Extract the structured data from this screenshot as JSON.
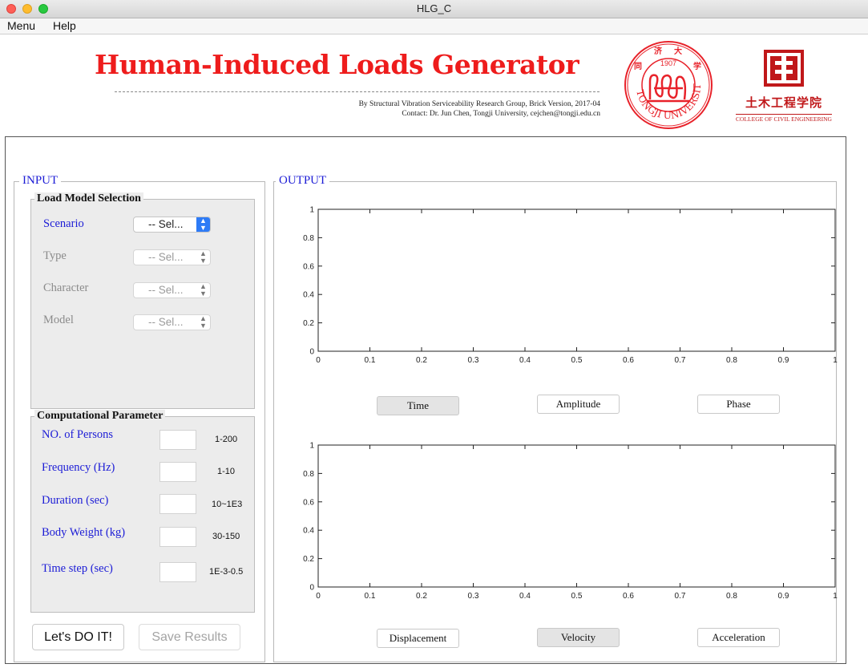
{
  "window": {
    "title": "HLG_C"
  },
  "menubar": {
    "items": [
      "Menu",
      "Help"
    ]
  },
  "header": {
    "title": "Human-Induced Loads Generator",
    "credit_line1": "By Structural Vibration Serviceability Research Group, Brick Version, 2017-04",
    "credit_line2": "Contact: Dr. Jun Chen, Tongji University, cejchen@tongji.edu.cn",
    "seal_year": "1907",
    "seal_text": "TONGJI UNIVERSITY",
    "college_cn": "土木工程学院",
    "college_en": "COLLEGE OF CIVIL ENGINEERING"
  },
  "input": {
    "title": "INPUT",
    "load_model": {
      "title": "Load Model Selection",
      "rows": [
        {
          "label": "Scenario",
          "value": "-- Sel...",
          "enabled": true
        },
        {
          "label": "Type",
          "value": "-- Sel...",
          "enabled": false
        },
        {
          "label": "Character",
          "value": "-- Sel...",
          "enabled": false
        },
        {
          "label": "Model",
          "value": "-- Sel...",
          "enabled": false
        }
      ]
    },
    "comp": {
      "title": "Computational Parameter",
      "rows": [
        {
          "label": "NO. of Persons",
          "range": "1-200",
          "value": ""
        },
        {
          "label": "Frequency (Hz)",
          "range": "1-10",
          "value": ""
        },
        {
          "label": "Duration (sec)",
          "range": "10~1E3",
          "value": ""
        },
        {
          "label": "Body Weight (kg)",
          "range": "30-150",
          "value": ""
        },
        {
          "label": "Time step (sec)",
          "range": "1E-3-0.5",
          "value": ""
        }
      ]
    },
    "run_label": "Let's DO IT!",
    "save_label": "Save Results"
  },
  "output": {
    "title": "OUTPUT",
    "top_buttons": [
      "Time",
      "Amplitude",
      "Phase"
    ],
    "bottom_buttons": [
      "Displacement",
      "Velocity",
      "Acceleration"
    ],
    "y_ticks": [
      "0",
      "0.2",
      "0.4",
      "0.6",
      "0.8",
      "1"
    ],
    "x_ticks": [
      "0",
      "0.1",
      "0.2",
      "0.3",
      "0.4",
      "0.5",
      "0.6",
      "0.7",
      "0.8",
      "0.9",
      "1"
    ]
  },
  "colors": {
    "title_red": "#ee1c1c",
    "label_blue": "#1c1cd6",
    "select_blue": "#2e7bf6",
    "brand_red": "#c0181a"
  }
}
